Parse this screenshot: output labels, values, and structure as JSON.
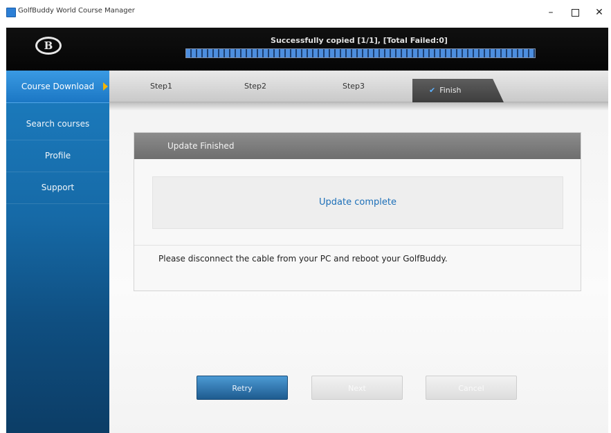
{
  "window": {
    "title": "GolfBuddy World Course Manager",
    "minimize_glyph": "–",
    "close_glyph": "✕"
  },
  "header": {
    "logo_letter": "B",
    "status_text": "Successfully copied [1/1], [Total Failed:0]",
    "progress_percent": 100
  },
  "sidebar": {
    "items": [
      {
        "label": "Course Download",
        "active": true
      },
      {
        "label": "Search courses",
        "active": false
      },
      {
        "label": "Profile",
        "active": false
      },
      {
        "label": "Support",
        "active": false
      }
    ]
  },
  "steps": [
    {
      "label": "Step1"
    },
    {
      "label": "Step2"
    },
    {
      "label": "Step3"
    },
    {
      "label": "Finish",
      "active": true
    }
  ],
  "panel": {
    "title": "Update Finished",
    "message": "Update complete",
    "info": "Please disconnect the cable from your PC and reboot your GolfBuddy."
  },
  "buttons": {
    "retry": "Retry",
    "next": "Next",
    "cancel": "Cancel"
  },
  "colors": {
    "sidebar_blue": "#1b77c4",
    "accent_arrow": "#f4b400",
    "message_blue": "#1c6fb8"
  },
  "icons": {
    "check": "✔"
  }
}
